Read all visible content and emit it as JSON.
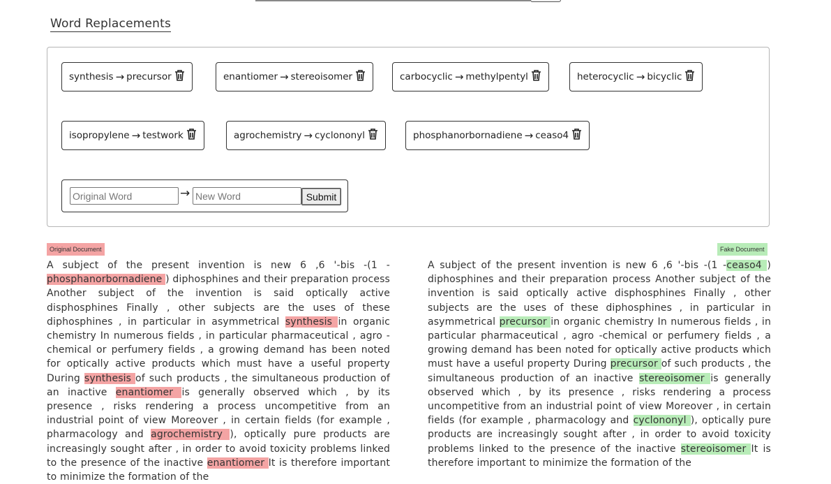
{
  "section_title": "Word Replacements",
  "arrow_glyph": "→",
  "trash_icon": "trash-icon",
  "colors": {
    "original_highlight": "#f4a4a4",
    "fake_highlight": "#b8ecb8"
  },
  "replacements": [
    {
      "original": "synthesis",
      "new": "precursor"
    },
    {
      "original": "enantiomer",
      "new": "stereoisomer"
    },
    {
      "original": "carbocyclic",
      "new": "methylpentyl"
    },
    {
      "original": "heterocyclic",
      "new": "bicyclic"
    },
    {
      "original": "isopropylene",
      "new": "testwork"
    },
    {
      "original": "agrochemistry",
      "new": "cyclononyl"
    },
    {
      "original": "phosphanorbornadiene",
      "new": "ceaso4"
    }
  ],
  "add_form": {
    "original_placeholder": "Original Word",
    "new_placeholder": "New Word",
    "submit_label": "Submit"
  },
  "original_document": {
    "label": "Original Document",
    "segments": [
      {
        "t": "A subject of the present invention is new 6 ,6 '-bis -(1 - "
      },
      {
        "t": "phosphanorbornadiene ",
        "hl": true
      },
      {
        "t": ") diphosphines and their preparation process Another subject of the invention is said optically active disphosphines Finally , other subjects are the uses of these diphosphines , in particular in asymmetrical "
      },
      {
        "t": "synthesis ",
        "hl": true
      },
      {
        "t": "in organic chemistry In numerous fields , in particular pharmaceutical , agro -chemical or perfumery fields , a growing demand has been noted for optically active products which must have a useful property During "
      },
      {
        "t": "synthesis ",
        "hl": true
      },
      {
        "t": "of such products , the simultaneous production of an inactive "
      },
      {
        "t": "enantiomer ",
        "hl": true
      },
      {
        "t": "is generally observed which , by its presence , risks rendering a process uncompetitive from an industrial point of view Moreover , in certain fields (for example , pharmacology and "
      },
      {
        "t": "agrochemistry ",
        "hl": true
      },
      {
        "t": "), optically pure products are increasingly sought after , in order to avoid toxicity problems linked to the presence of the inactive "
      },
      {
        "t": "enantiomer ",
        "hl": true
      },
      {
        "t": "It is therefore important to minimize the formation of the"
      }
    ]
  },
  "fake_document": {
    "label": "Fake Document",
    "segments": [
      {
        "t": "A subject of the present invention is new 6 ,6 '-bis -(1 -"
      },
      {
        "t": "ceaso4 ",
        "hl": true
      },
      {
        "t": ") diphosphines and their preparation process Another subject of the invention is said optically active disphosphines Finally , other subjects are the uses of these diphosphines , in particular in asymmetrical "
      },
      {
        "t": "precursor ",
        "hl": true
      },
      {
        "t": "in organic chemistry In numerous fields , in particular pharmaceutical , agro -chemical or perfumery fields , a growing demand has been noted for optically active products which must have a useful property During "
      },
      {
        "t": "precursor ",
        "hl": true
      },
      {
        "t": "of such products , the simultaneous production of an inactive "
      },
      {
        "t": "stereoisomer ",
        "hl": true
      },
      {
        "t": "is generally observed which , by its presence , risks rendering a process uncompetitive from an industrial point of view Moreover , in certain fields (for example , pharmacology and "
      },
      {
        "t": "cyclononyl ",
        "hl": true
      },
      {
        "t": "), optically pure products are increasingly sought after , in order to avoid toxicity problems linked to the presence of the inactive "
      },
      {
        "t": "stereoisomer ",
        "hl": true
      },
      {
        "t": "It is therefore important to minimize the formation of the"
      }
    ]
  }
}
